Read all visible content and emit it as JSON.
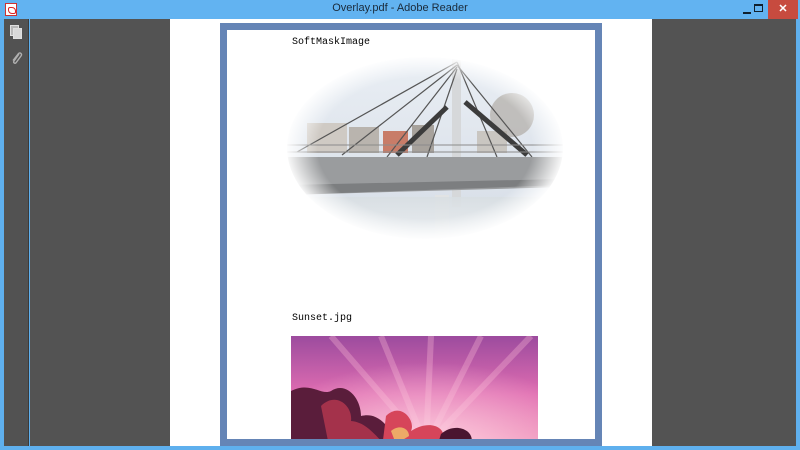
{
  "window": {
    "title": "Overlay.pdf - Adobe Reader",
    "minimize_label": "",
    "maximize_label": "",
    "close_label": "✕",
    "accent_color": "#62b3f1",
    "close_color": "#c74b3f"
  },
  "sidebar": {
    "items": [
      {
        "icon": "pages-icon"
      },
      {
        "icon": "paperclip-icon"
      }
    ]
  },
  "document": {
    "labels": [
      "SoftMaskImage",
      "Sunset.jpg"
    ],
    "images": [
      {
        "name": "softmask-bridge-image",
        "description_visible": false
      },
      {
        "name": "sunset-image",
        "description_visible": false
      }
    ]
  }
}
